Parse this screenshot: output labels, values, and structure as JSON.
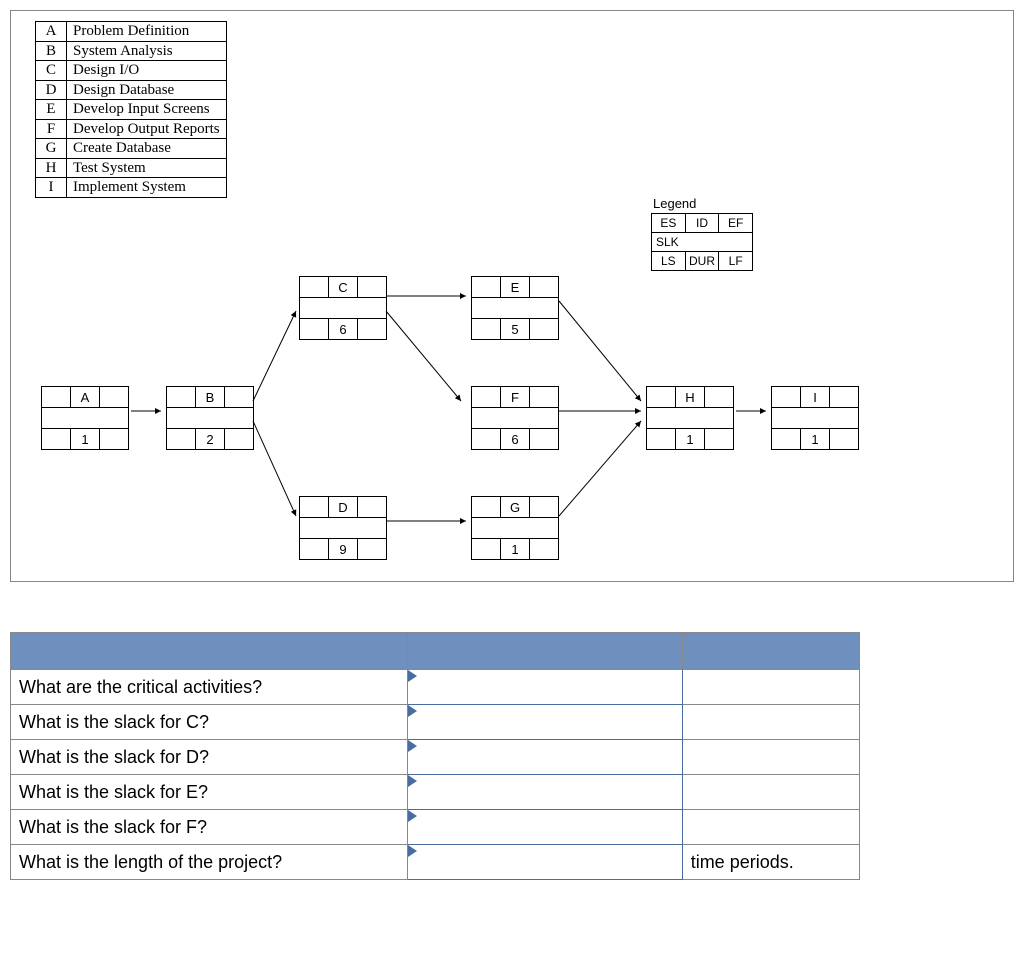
{
  "activities": [
    {
      "id": "A",
      "name": "Problem Definition"
    },
    {
      "id": "B",
      "name": "System Analysis"
    },
    {
      "id": "C",
      "name": "Design I/O"
    },
    {
      "id": "D",
      "name": "Design Database"
    },
    {
      "id": "E",
      "name": "Develop Input Screens"
    },
    {
      "id": "F",
      "name": "Develop Output Reports"
    },
    {
      "id": "G",
      "name": "Create Database"
    },
    {
      "id": "H",
      "name": "Test System"
    },
    {
      "id": "I",
      "name": "Implement System"
    }
  ],
  "legend": {
    "title": "Legend",
    "row1": [
      "ES",
      "ID",
      "EF"
    ],
    "row2": "SLK",
    "row3": [
      "LS",
      "DUR",
      "LF"
    ]
  },
  "nodes": {
    "A": {
      "id": "A",
      "dur": "1"
    },
    "B": {
      "id": "B",
      "dur": "2"
    },
    "C": {
      "id": "C",
      "dur": "6"
    },
    "D": {
      "id": "D",
      "dur": "9"
    },
    "E": {
      "id": "E",
      "dur": "5"
    },
    "F": {
      "id": "F",
      "dur": "6"
    },
    "G": {
      "id": "G",
      "dur": "1"
    },
    "H": {
      "id": "H",
      "dur": "1"
    },
    "I": {
      "id": "I",
      "dur": "1"
    }
  },
  "questions": [
    "What are the critical activities?",
    "What is the slack for C?",
    "What is the slack for D?",
    "What is the slack for E?",
    "What is the slack for F?",
    "What is the length of the project?"
  ],
  "tail_label": "time periods."
}
